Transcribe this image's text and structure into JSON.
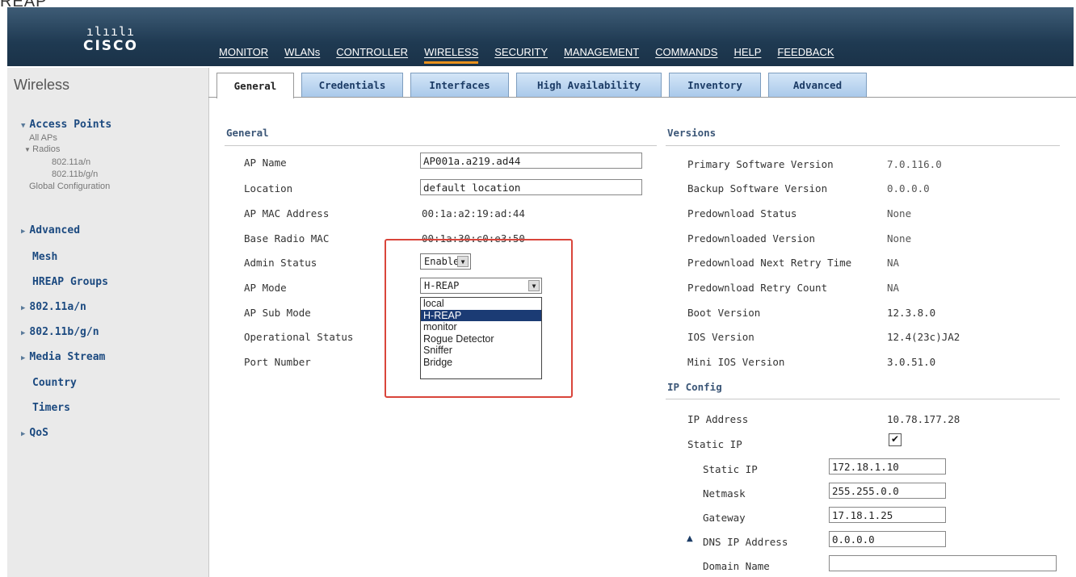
{
  "caption": "REAP",
  "header": {
    "logo_bars": "ılıılı",
    "logo_word": "CISCO",
    "nav": [
      "MONITOR",
      "WLANs",
      "CONTROLLER",
      "WIRELESS",
      "SECURITY",
      "MANAGEMENT",
      "COMMANDS",
      "HELP",
      "FEEDBACK"
    ],
    "active_nav": "WIRELESS"
  },
  "sidebar": {
    "title": "Wireless",
    "access_points": "Access Points",
    "all_aps": "All APs",
    "radios": "Radios",
    "radio_a": "802.11a/n",
    "radio_bg": "802.11b/g/n",
    "global_config": "Global Configuration",
    "advanced": "Advanced",
    "mesh": "Mesh",
    "hreap_groups": "HREAP Groups",
    "r80211an": "802.11a/n",
    "r80211bgn": "802.11b/g/n",
    "media_stream": "Media Stream",
    "country": "Country",
    "timers": "Timers",
    "qos": "QoS"
  },
  "tabs": [
    "General",
    "Credentials",
    "Interfaces",
    "High Availability",
    "Inventory",
    "Advanced"
  ],
  "general": {
    "title": "General",
    "ap_name_label": "AP Name",
    "ap_name": "AP001a.a219.ad44",
    "location_label": "Location",
    "location": "default location",
    "mac_label": "AP MAC Address",
    "mac": "00:1a:a2:19:ad:44",
    "base_mac_label": "Base Radio MAC",
    "base_mac": "00:1a:30:c0:e3:50",
    "admin_label": "Admin Status",
    "admin_value": "Enable",
    "mode_label": "AP Mode",
    "mode_value": "H-REAP",
    "submode_label": "AP Sub Mode",
    "opstatus_label": "Operational Status",
    "port_label": "Port Number",
    "mode_options": [
      "local",
      "H-REAP",
      "monitor",
      "Rogue Detector",
      "Sniffer",
      "Bridge"
    ]
  },
  "versions": {
    "title": "Versions",
    "rows": [
      {
        "label": "Primary Software Version",
        "value": "7.0.116.0"
      },
      {
        "label": "Backup Software Version",
        "value": "0.0.0.0"
      },
      {
        "label": "Predownload Status",
        "value": "None"
      },
      {
        "label": "Predownloaded Version",
        "value": "None"
      },
      {
        "label": "Predownload Next Retry Time",
        "value": "NA"
      },
      {
        "label": "Predownload Retry Count",
        "value": "NA"
      },
      {
        "label": "Boot Version",
        "value": "12.3.8.0"
      },
      {
        "label": "IOS Version",
        "value": "12.4(23c)JA2"
      },
      {
        "label": "Mini IOS Version",
        "value": "3.0.51.0"
      }
    ]
  },
  "ipconfig": {
    "title": "IP Config",
    "ip_label": "IP Address",
    "ip": "10.78.177.28",
    "static_label": "Static IP",
    "static_checked": "✔",
    "static_ip_label": "Static IP",
    "static_ip": "172.18.1.10",
    "netmask_label": "Netmask",
    "netmask": "255.255.0.0",
    "gateway_label": "Gateway",
    "gateway": "17.18.1.25",
    "dns_label": "DNS IP Address",
    "dns": "0.0.0.0",
    "domain_label": "Domain Name",
    "domain": ""
  }
}
